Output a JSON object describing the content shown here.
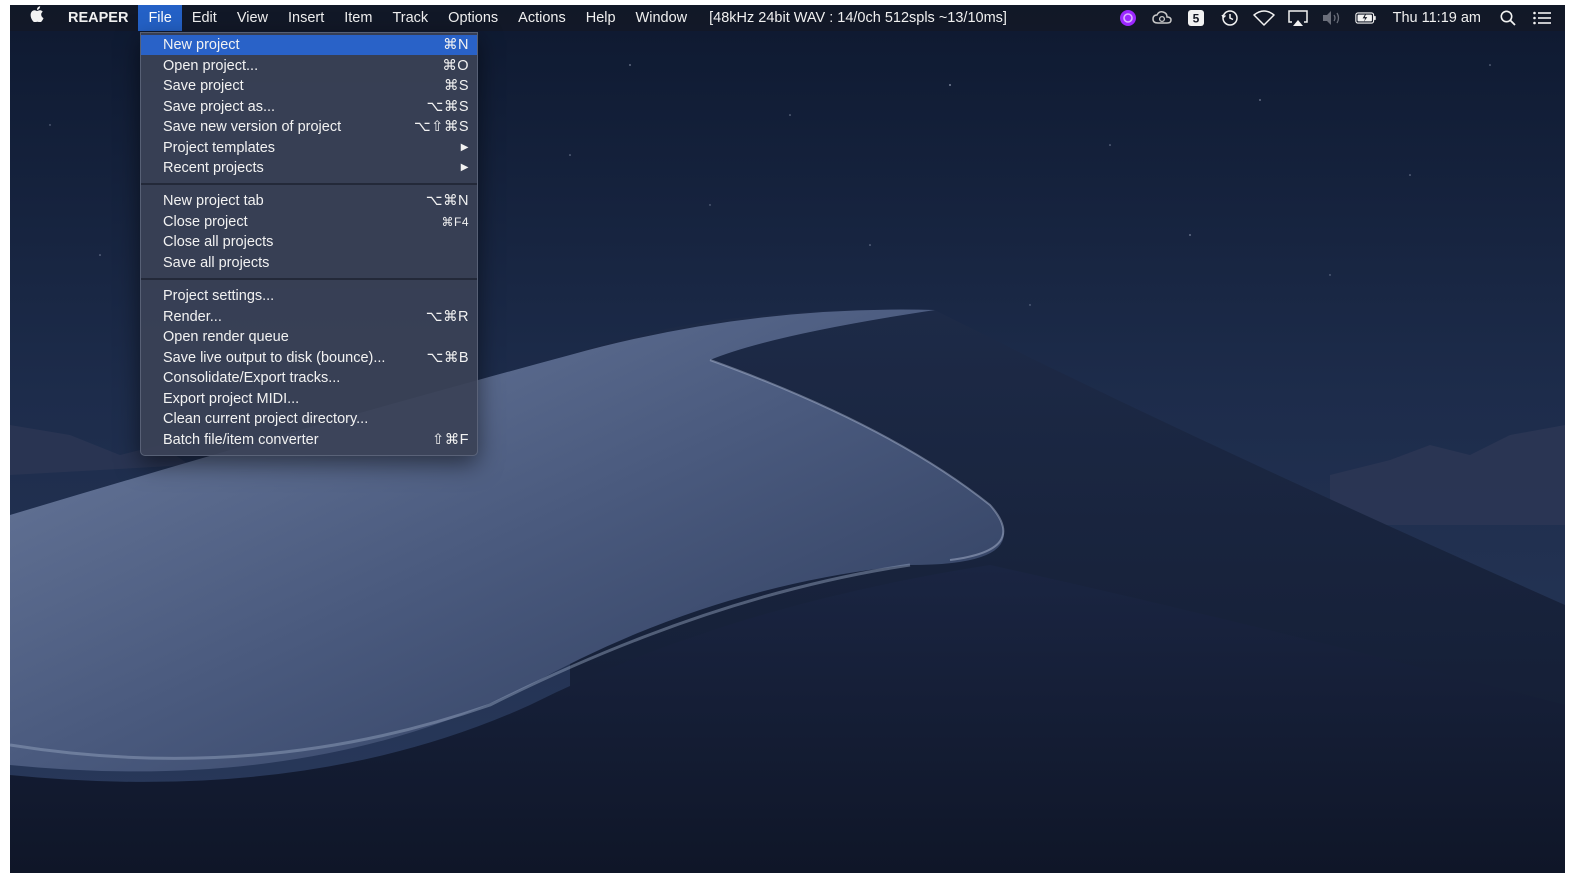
{
  "menubar": {
    "apple_icon": "apple-logo-icon",
    "app_name": "REAPER",
    "menus": [
      "File",
      "Edit",
      "View",
      "Insert",
      "Item",
      "Track",
      "Options",
      "Actions",
      "Help",
      "Window"
    ],
    "active_menu": "File",
    "audio_status": "[48kHz 24bit WAV : 14/0ch 512spls ~13/10ms]",
    "status_icons": [
      "purple-app-icon",
      "creative-cloud-icon",
      "notion-icon",
      "time-machine-icon",
      "wifi-icon",
      "airplay-icon",
      "volume-icon",
      "battery-icon"
    ],
    "clock": "Thu 11:19 am",
    "search_icon": "spotlight-search-icon",
    "notification_icon": "notification-center-icon"
  },
  "file_menu": {
    "groups": [
      [
        {
          "label": "New project",
          "shortcut": "⌘N",
          "highlighted": true
        },
        {
          "label": "Open project...",
          "shortcut": "⌘O"
        },
        {
          "label": "Save project",
          "shortcut": "⌘S"
        },
        {
          "label": "Save project as...",
          "shortcut": "⌥⌘S"
        },
        {
          "label": "Save new version of project",
          "shortcut": "⌥⇧⌘S"
        },
        {
          "label": "Project templates",
          "shortcut": "▶"
        },
        {
          "label": "Recent projects",
          "shortcut": "▶"
        }
      ],
      [
        {
          "label": "New project tab",
          "shortcut": "⌥⌘N"
        },
        {
          "label": "Close project",
          "shortcut": "⌘F4"
        },
        {
          "label": "Close all projects",
          "shortcut": ""
        },
        {
          "label": "Save all projects",
          "shortcut": ""
        }
      ],
      [
        {
          "label": "Project settings...",
          "shortcut": ""
        },
        {
          "label": "Render...",
          "shortcut": "⌥⌘R"
        },
        {
          "label": "Open render queue",
          "shortcut": ""
        },
        {
          "label": "Save live output to disk (bounce)...",
          "shortcut": "⌥⌘B"
        },
        {
          "label": "Consolidate/Export tracks...",
          "shortcut": ""
        },
        {
          "label": "Export project MIDI...",
          "shortcut": ""
        },
        {
          "label": "Clean current project directory...",
          "shortcut": ""
        },
        {
          "label": "Batch file/item converter",
          "shortcut": "⇧⌘F"
        }
      ]
    ]
  },
  "colors": {
    "menu_highlight": "#2962c8",
    "menubar_bg": "#141824",
    "menu_bg": "#3a4256",
    "accent_purple": "#9b27ff"
  }
}
